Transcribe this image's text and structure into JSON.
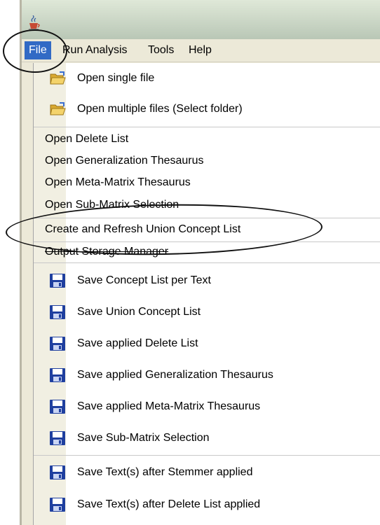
{
  "menubar": {
    "items": [
      {
        "label": "File",
        "active": true
      },
      {
        "label": "Run Analysis"
      },
      {
        "label": "Tools"
      },
      {
        "label": "Help"
      }
    ]
  },
  "file_menu": {
    "open_single": {
      "label": "Open single file",
      "icon": "folder-open-icon"
    },
    "open_multiple": {
      "label": "Open multiple files (Select folder)",
      "icon": "folder-open-icon"
    },
    "open_delete_list": {
      "label": "Open Delete List",
      "has_submenu": true
    },
    "open_generalization": {
      "label": "Open Generalization Thesaurus",
      "has_submenu": true
    },
    "open_meta_matrix": {
      "label": "Open Meta-Matrix Thesaurus",
      "has_submenu": true
    },
    "open_sub_matrix": {
      "label": "Open Sub-Matrix Selection",
      "has_submenu": true
    },
    "create_union": {
      "label": "Create and Refresh Union Concept List"
    },
    "output_storage": {
      "label": "Output Storage Manager"
    },
    "save_concept_per_text": {
      "label": "Save Concept List per Text",
      "icon": "floppy-disk-icon"
    },
    "save_union": {
      "label": "Save Union Concept List",
      "icon": "floppy-disk-icon"
    },
    "save_delete": {
      "label": "Save applied Delete List",
      "icon": "floppy-disk-icon"
    },
    "save_generalization": {
      "label": "Save applied Generalization Thesaurus",
      "icon": "floppy-disk-icon"
    },
    "save_meta_matrix": {
      "label": "Save applied Meta-Matrix Thesaurus",
      "icon": "floppy-disk-icon"
    },
    "save_sub_matrix": {
      "label": "Save Sub-Matrix Selection",
      "icon": "floppy-disk-icon"
    },
    "save_text_stemmer": {
      "label": "Save Text(s) after Stemmer applied",
      "icon": "floppy-disk-icon"
    },
    "save_text_delete": {
      "label": "Save Text(s) after Delete List applied",
      "icon": "floppy-disk-icon"
    }
  },
  "colors": {
    "menu_highlight": "#316ac5",
    "menu_bg": "#ece9d8",
    "floppy": "#1f3f9f"
  }
}
